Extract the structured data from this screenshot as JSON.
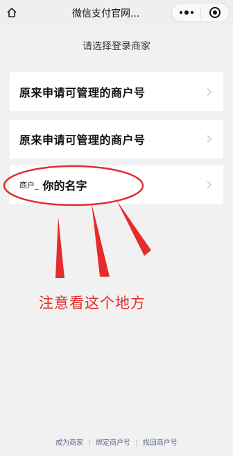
{
  "nav": {
    "title": "微信支付官网...",
    "home_icon": "home-icon",
    "more_icon": "more-dots-icon",
    "close_icon": "target-close-icon"
  },
  "subtitle": "请选择登录商家",
  "cards": [
    {
      "title": "原来申请可管理的商户号"
    },
    {
      "title": "原来申请可管理的商户号"
    }
  ],
  "merchant": {
    "prefix": "商户_",
    "name": "你的名字"
  },
  "annotation": {
    "note": "注意看这个地方",
    "color": "#e52b2b"
  },
  "footer": {
    "links": [
      "成为商家",
      "绑定商户号",
      "找回商户号"
    ],
    "divider": "|"
  }
}
